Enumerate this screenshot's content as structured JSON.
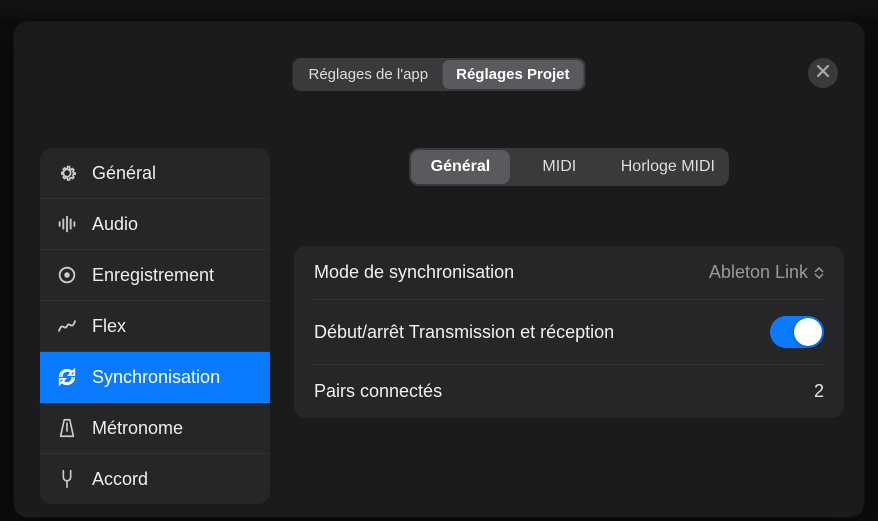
{
  "top_tabs": [
    {
      "label": "Réglages de l'app",
      "active": false
    },
    {
      "label": "Réglages Projet",
      "active": true
    }
  ],
  "sidebar": {
    "items": [
      {
        "icon": "gear-icon",
        "label": "Général"
      },
      {
        "icon": "audio-bars-icon",
        "label": "Audio"
      },
      {
        "icon": "record-icon",
        "label": "Enregistrement"
      },
      {
        "icon": "flex-icon",
        "label": "Flex"
      },
      {
        "icon": "sync-icon",
        "label": "Synchronisation",
        "active": true
      },
      {
        "icon": "metronome-icon",
        "label": "Métronome"
      },
      {
        "icon": "tuning-fork-icon",
        "label": "Accord"
      }
    ]
  },
  "content_tabs": [
    {
      "label": "Général",
      "active": true
    },
    {
      "label": "MIDI",
      "active": false
    },
    {
      "label": "Horloge MIDI",
      "active": false
    }
  ],
  "panel": {
    "rows": [
      {
        "label": "Mode de synchronisation",
        "value": "Ableton Link",
        "type": "dropdown"
      },
      {
        "label": "Début/arrêt Transmission et réception",
        "toggle_on": true,
        "type": "toggle"
      },
      {
        "label": "Pairs connectés",
        "value": "2",
        "type": "static"
      }
    ]
  },
  "close_button_label": "Fermer"
}
